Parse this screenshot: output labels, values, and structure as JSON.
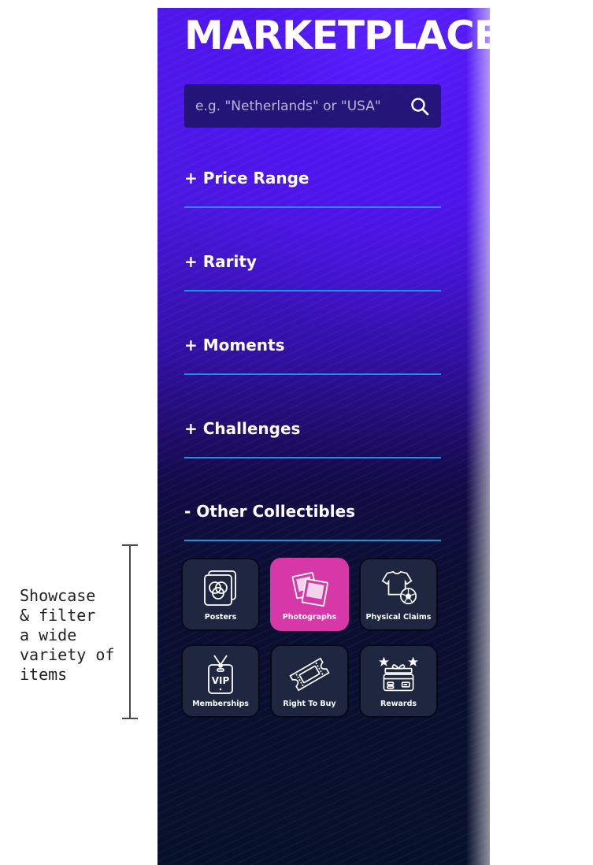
{
  "annotation": {
    "lines": [
      "Showcase",
      "& filter",
      "a wide",
      "variety of",
      "items"
    ]
  },
  "marketplace": {
    "title": "MARKETPLACE",
    "search": {
      "placeholder": "e.g. \"Netherlands\" or \"USA\"",
      "value": ""
    },
    "filters": [
      {
        "label": "+ Price Range"
      },
      {
        "label": "+ Rarity"
      },
      {
        "label": "+ Moments"
      },
      {
        "label": "+ Challenges"
      },
      {
        "label": "- Other Collectibles"
      }
    ],
    "collectibles": [
      {
        "label": "Posters",
        "icon": "posters-icon",
        "active": false
      },
      {
        "label": "Photographs",
        "icon": "photographs-icon",
        "active": true
      },
      {
        "label": "Physical Claims",
        "icon": "physical-claims-icon",
        "active": false
      },
      {
        "label": "Memberships",
        "icon": "vip-pass-icon",
        "active": false
      },
      {
        "label": "Right To Buy",
        "icon": "ticket-icon",
        "active": false
      },
      {
        "label": "Rewards",
        "icon": "gift-card-icon",
        "active": false
      }
    ]
  },
  "colors": {
    "accent_active": "#d638a8",
    "divider": "#1f8fe8",
    "tile_bg": "#1f2740"
  }
}
